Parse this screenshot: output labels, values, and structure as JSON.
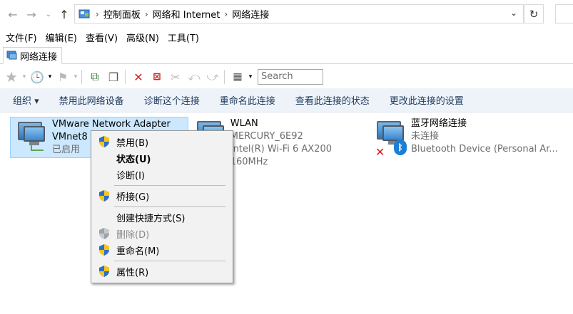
{
  "address": {
    "crumbs": [
      "控制面板",
      "网络和 Internet",
      "网络连接"
    ],
    "refresh_icon": "refresh-icon"
  },
  "menu": [
    "文件(F)",
    "编辑(E)",
    "查看(V)",
    "高级(N)",
    "工具(T)"
  ],
  "tab": {
    "label": "网络连接"
  },
  "toolbar": {
    "search_placeholder": "Search"
  },
  "commands": [
    "组织 ▾",
    "禁用此网络设备",
    "诊断这个连接",
    "重命名此连接",
    "查看此连接的状态",
    "更改此连接的设置"
  ],
  "items": [
    {
      "name": "VMware Network Adapter",
      "line2": "VMnet8",
      "line3": "已启用"
    },
    {
      "name": "WLAN",
      "line2": "MERCURY_6E92",
      "line3": "Intel(R) Wi-Fi 6 AX200 160MHz"
    },
    {
      "name": "蓝牙网络连接",
      "line2": "未连接",
      "line3": "Bluetooth Device (Personal Ar..."
    }
  ],
  "context_menu": {
    "disable": "禁用(B)",
    "status": "状态(U)",
    "diagnose": "诊断(I)",
    "bridge": "桥接(G)",
    "shortcut": "创建快捷方式(S)",
    "delete": "删除(D)",
    "rename": "重命名(M)",
    "properties": "属性(R)"
  },
  "colors": {
    "selection": "#cce8ff",
    "command_bar": "#eef3fa",
    "command_text": "#1e395b"
  }
}
